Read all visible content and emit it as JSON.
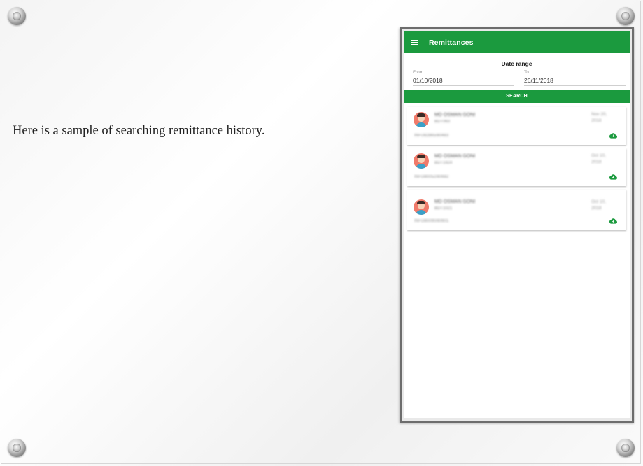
{
  "caption": "Here is a sample of searching remittance history.",
  "app": {
    "title": "Remittances",
    "accent_color": "#1b9a3e"
  },
  "date_range": {
    "title": "Date range",
    "from_label": "From",
    "from_value": "01/10/2018",
    "to_label": "To",
    "to_value": "26/11/2018"
  },
  "search": {
    "label": "SEARCH"
  },
  "remittances": [
    {
      "name": "MD OSMAN GONI",
      "ref": "BDT063",
      "date": "Nov 20, 2018",
      "id": "INFU82865/80483",
      "icon": "cloud-download-icon"
    },
    {
      "name": "MD OSMAN GONI",
      "ref": "BDT1924",
      "date": "Oct 10, 2018",
      "id": "INFO80052/80682",
      "icon": "cloud-download-icon"
    },
    {
      "name": "MD OSMAN GONI",
      "ref": "BDT1021",
      "date": "Oct 10, 2018",
      "id": "INFO80090/80601",
      "icon": "cloud-download-icon"
    }
  ]
}
